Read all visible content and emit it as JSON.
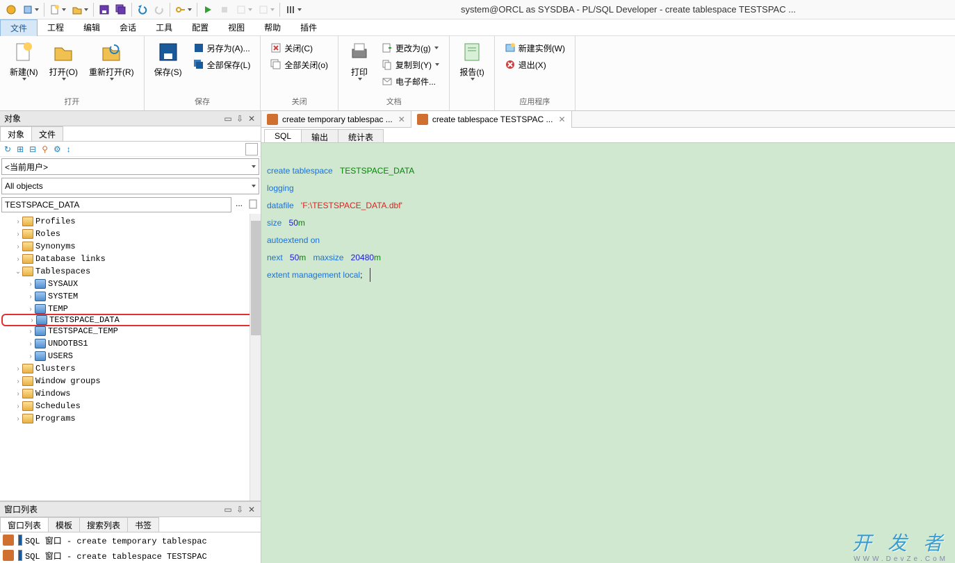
{
  "app_title": "system@ORCL as SYSDBA - PL/SQL Developer - create tablespace TESTSPAC ...",
  "menus": [
    "文件",
    "工程",
    "编辑",
    "会话",
    "工具",
    "配置",
    "视图",
    "帮助",
    "插件"
  ],
  "menu_active_index": 0,
  "ribbon": {
    "open_group_label": "打开",
    "save_group_label": "保存",
    "close_group_label": "关闭",
    "print_label": "打印",
    "doc_group_label": "文档",
    "report_label": "报告(t)",
    "app_group_label": "应用程序",
    "new_btn": "新建(N)",
    "open_btn": "打开(O)",
    "reopen_btn": "重新打开(R)",
    "save_btn": "保存(S)",
    "saveas_btn": "另存为(A)...",
    "saveall_btn": "全部保存(L)",
    "close_btn": "关闭(C)",
    "closeall_btn": "全部关闭(o)",
    "changeto_btn": "更改为(g)",
    "copyto_btn": "复制到(Y)",
    "email_btn": "电子邮件...",
    "newinstance_btn": "新建实例(W)",
    "exit_btn": "退出(X)"
  },
  "left": {
    "objects_title": "对象",
    "tab_objects": "对象",
    "tab_files": "文件",
    "user_combo": "<当前用户>",
    "filter_combo": "All objects",
    "filter_value": "TESTSPACE_DATA",
    "tree": [
      {
        "label": "Profiles",
        "depth": 1,
        "icon": "folder",
        "chev": "›"
      },
      {
        "label": "Roles",
        "depth": 1,
        "icon": "folder",
        "chev": "›"
      },
      {
        "label": "Synonyms",
        "depth": 1,
        "icon": "folder",
        "chev": "›"
      },
      {
        "label": "Database links",
        "depth": 1,
        "icon": "folder",
        "chev": "›"
      },
      {
        "label": "Tablespaces",
        "depth": 1,
        "icon": "folder",
        "chev": "⌄",
        "expanded": true
      },
      {
        "label": "SYSAUX",
        "depth": 2,
        "icon": "db",
        "chev": "›"
      },
      {
        "label": "SYSTEM",
        "depth": 2,
        "icon": "db",
        "chev": "›"
      },
      {
        "label": "TEMP",
        "depth": 2,
        "icon": "db",
        "chev": "›"
      },
      {
        "label": "TESTSPACE_DATA",
        "depth": 2,
        "icon": "db",
        "chev": "›",
        "highlight": true
      },
      {
        "label": "TESTSPACE_TEMP",
        "depth": 2,
        "icon": "db",
        "chev": "›"
      },
      {
        "label": "UNDOTBS1",
        "depth": 2,
        "icon": "db",
        "chev": "›"
      },
      {
        "label": "USERS",
        "depth": 2,
        "icon": "db",
        "chev": "›"
      },
      {
        "label": "Clusters",
        "depth": 1,
        "icon": "folder",
        "chev": "›"
      },
      {
        "label": "Window groups",
        "depth": 1,
        "icon": "folder",
        "chev": "›"
      },
      {
        "label": "Windows",
        "depth": 1,
        "icon": "folder",
        "chev": "›"
      },
      {
        "label": "Schedules",
        "depth": 1,
        "icon": "folder",
        "chev": "›"
      },
      {
        "label": "Programs",
        "depth": 1,
        "icon": "folder",
        "chev": "›"
      }
    ],
    "windowlist_title": "窗口列表",
    "wl_tabs": [
      "窗口列表",
      "模板",
      "搜索列表",
      "书签"
    ],
    "wl_items": [
      "SQL 窗口 - create temporary tablespac",
      "SQL 窗口 - create tablespace TESTSPAC"
    ]
  },
  "editor": {
    "tabs": [
      {
        "label": "create temporary tablespac ...",
        "active": false
      },
      {
        "label": "create tablespace TESTSPAC ...",
        "active": true
      }
    ],
    "subtabs": [
      "SQL",
      "输出",
      "统计表"
    ],
    "subtab_active": 0,
    "sql": {
      "l1_kw": "create tablespace",
      "l1_ident": "TESTSPACE_DATA",
      "l2_kw": "logging",
      "l3_kw": "datafile",
      "l3_str": "'F:\\TESTSPACE_DATA.dbf'",
      "l4_kw": "size",
      "l4_num": "50",
      "l4_ident": "m",
      "l5_kw": "autoextend on",
      "l6_kw": "next",
      "l6_num": "50",
      "l6_ident": "m",
      "l6_kw2": "maxsize",
      "l6_num2": "20480",
      "l6_ident2": "m",
      "l7_kw": "extent management local",
      "l7_semi": ";"
    }
  },
  "watermark": "开 发 者",
  "watermark2": "WWW.DevZe.CoM"
}
